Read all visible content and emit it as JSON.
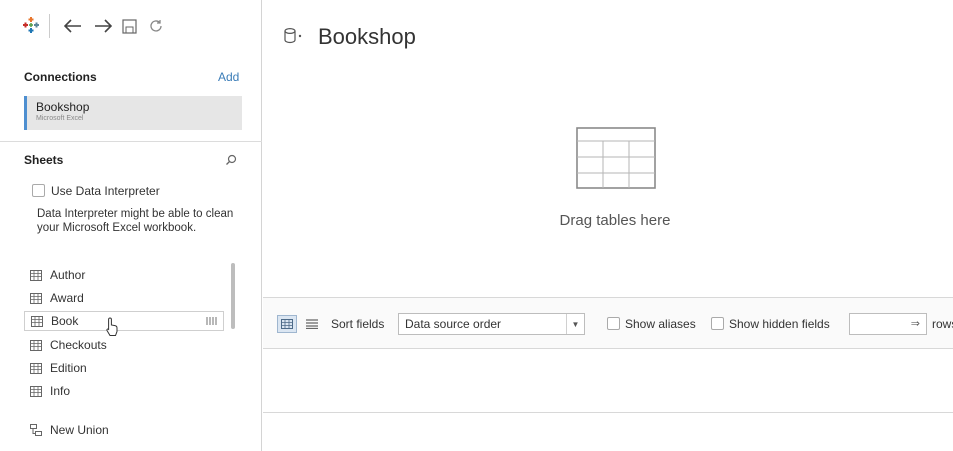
{
  "toolbar": {
    "icons": [
      "tableau-logo-icon",
      "back-icon",
      "forward-icon",
      "save-icon",
      "refresh-icon"
    ]
  },
  "connections": {
    "title": "Connections",
    "add_label": "Add",
    "items": [
      {
        "name": "Bookshop",
        "type": "Microsoft Excel"
      }
    ]
  },
  "sheets": {
    "title": "Sheets",
    "use_data_interpreter": "Use Data Interpreter",
    "interpreter_description": "Data Interpreter might be able to clean your Microsoft Excel workbook.",
    "items": [
      {
        "label": "Author"
      },
      {
        "label": "Award"
      },
      {
        "label": "Book"
      },
      {
        "label": "Checkouts"
      },
      {
        "label": "Edition"
      },
      {
        "label": "Info"
      }
    ],
    "new_union": "New Union"
  },
  "main": {
    "datasource_title": "Bookshop",
    "drag_text": "Drag tables here"
  },
  "grid_toolbar": {
    "sort_fields_label": "Sort fields",
    "sort_selected": "Data source order",
    "show_aliases": "Show aliases",
    "show_hidden_fields": "Show hidden fields",
    "rows_arrow": "⇒",
    "rows_label": "rows"
  },
  "colors": {
    "accent": "#4e8fd0",
    "link": "#3b7db8"
  }
}
